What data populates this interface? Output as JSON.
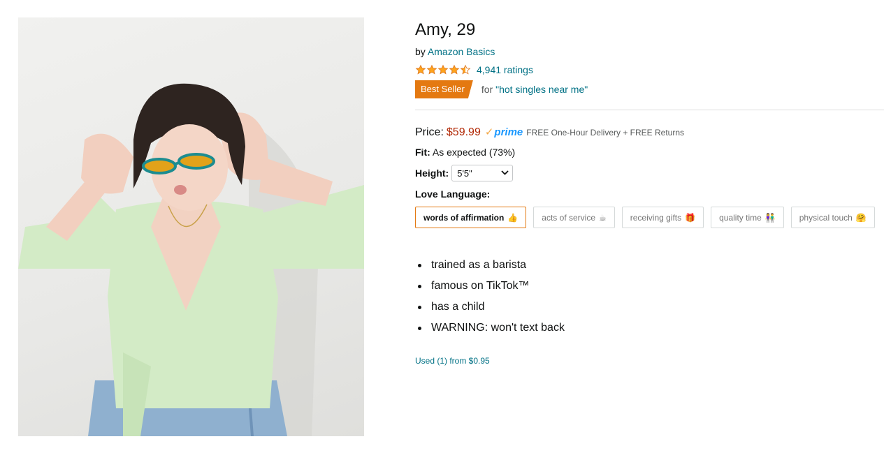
{
  "product": {
    "title": "Amy, 29",
    "by_prefix": "by",
    "brand": "Amazon Basics",
    "rating_stars": 4.5,
    "ratings_text": "4,941 ratings",
    "badge": "Best Seller",
    "badge_context_prefix": "for",
    "badge_context_link": "\"hot singles near me\""
  },
  "pricing": {
    "price_label": "Price:",
    "price": "$59.99",
    "prime_label": "prime",
    "delivery": "FREE One-Hour Delivery + FREE Returns"
  },
  "fit": {
    "label": "Fit:",
    "value": "As expected (73%)"
  },
  "height": {
    "label": "Height:",
    "selected": "5'5\""
  },
  "love_language": {
    "label": "Love Language:",
    "options": [
      {
        "label": "words of affirmation",
        "emoji": "👍",
        "selected": true
      },
      {
        "label": "acts of service",
        "emoji": "☕",
        "selected": false
      },
      {
        "label": "receiving gifts",
        "emoji": "🎁",
        "selected": false
      },
      {
        "label": "quality time",
        "emoji": "👫",
        "selected": false
      },
      {
        "label": "physical touch",
        "emoji": "🤗",
        "selected": false
      }
    ]
  },
  "bullets": [
    "trained as a barista",
    "famous on TikTok™",
    "has a child",
    "WARNING: won't text back"
  ],
  "used_offer": "Used (1) from $0.95",
  "colors": {
    "link": "#007185",
    "price": "#b12704",
    "badge": "#e47911",
    "star": "#ffa41c",
    "prime": "#1a98ff",
    "selected_border": "#e47911"
  },
  "icons": {
    "star": "star-icon",
    "half_star": "half-star-icon",
    "prime_check": "check-icon",
    "dropdown": "chevron-down-icon"
  }
}
